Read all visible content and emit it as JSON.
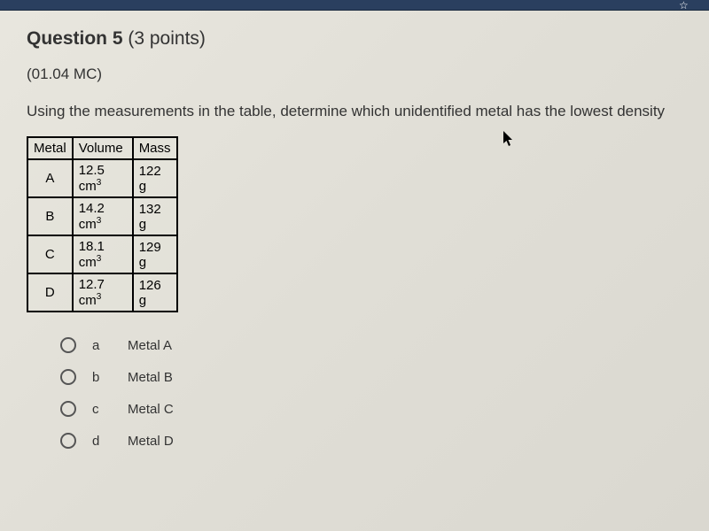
{
  "browser": {
    "star_icon": "☆"
  },
  "question": {
    "title_prefix": "Question 5",
    "title_points": " (3 points)",
    "code": "(01.04 MC)",
    "text": "Using the measurements in the table, determine which unidentified metal has the lowest density",
    "table": {
      "headers": {
        "metal": "Metal",
        "volume": "Volume",
        "mass": "Mass"
      },
      "rows": [
        {
          "metal": "A",
          "volume_num": "12.5 cm",
          "volume_sup": "3",
          "mass": "122 g"
        },
        {
          "metal": "B",
          "volume_num": "14.2 cm",
          "volume_sup": "3",
          "mass": "132 g"
        },
        {
          "metal": "C",
          "volume_num": "18.1 cm",
          "volume_sup": "3",
          "mass": "129 g"
        },
        {
          "metal": "D",
          "volume_num": "12.7 cm",
          "volume_sup": "3",
          "mass": "126 g"
        }
      ]
    },
    "options": [
      {
        "letter": "a",
        "label": "Metal A"
      },
      {
        "letter": "b",
        "label": "Metal B"
      },
      {
        "letter": "c",
        "label": "Metal C"
      },
      {
        "letter": "d",
        "label": "Metal D"
      }
    ]
  }
}
